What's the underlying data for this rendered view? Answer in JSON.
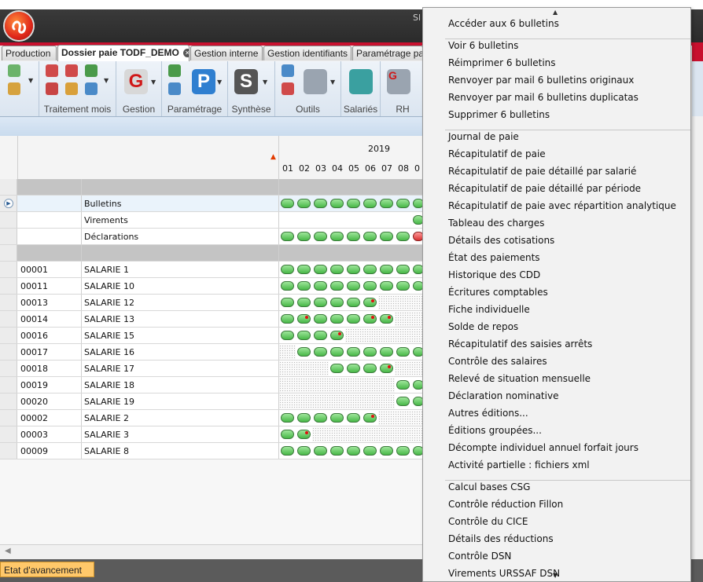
{
  "window": {
    "title": "Sl"
  },
  "tabs": [
    {
      "label": "Production"
    },
    {
      "label": "Dossier paie TODF_DEMO",
      "active": true
    },
    {
      "label": "Gestion interne"
    },
    {
      "label": "Gestion identifiants"
    },
    {
      "label": "Paramétrage pa"
    }
  ],
  "ribbon": {
    "groups": [
      {
        "label": "Traitement mois"
      },
      {
        "label": "Gestion",
        "letter": "G"
      },
      {
        "label": "Paramétrage",
        "letter": "P"
      },
      {
        "label": "Synthèse",
        "letter": "S"
      },
      {
        "label": "Outils"
      },
      {
        "label": "Salariés"
      },
      {
        "label": "RH",
        "letter": "G"
      }
    ]
  },
  "grid": {
    "year": "2019",
    "months": [
      "01",
      "02",
      "03",
      "04",
      "05",
      "06",
      "07",
      "08",
      "0"
    ],
    "summary_rows": [
      {
        "label": "Bulletins",
        "selected": true,
        "cells": [
          "g",
          "g",
          "g",
          "g",
          "g",
          "g",
          "g",
          "g",
          "gc"
        ]
      },
      {
        "label": "Virements",
        "cells": [
          "",
          "",
          "",
          "",
          "",
          "",
          "",
          "",
          "gc"
        ]
      },
      {
        "label": "Déclarations",
        "cells": [
          "g",
          "g",
          "g",
          "g",
          "g",
          "g",
          "g",
          "g",
          "rc"
        ]
      }
    ],
    "employees": [
      {
        "code": "00001",
        "name": "SALARIE 1",
        "cells": [
          "g",
          "g",
          "g",
          "g",
          "g",
          "g",
          "g",
          "g",
          "gc"
        ]
      },
      {
        "code": "00011",
        "name": "SALARIE 10",
        "cells": [
          "g",
          "g",
          "g",
          "g",
          "g",
          "g",
          "g",
          "g",
          "gc"
        ]
      },
      {
        "code": "00013",
        "name": "SALARIE 12",
        "cells": [
          "g",
          "g",
          "g",
          "g",
          "g",
          "gd",
          ".",
          ".",
          "."
        ]
      },
      {
        "code": "00014",
        "name": "SALARIE 13",
        "cells": [
          "g",
          "gd",
          "g",
          "g",
          "g",
          "gd",
          "gd",
          ".",
          "."
        ]
      },
      {
        "code": "00016",
        "name": "SALARIE 15",
        "cells": [
          "g",
          "g",
          "g",
          "gd",
          ".",
          ".",
          ".",
          ".",
          "."
        ]
      },
      {
        "code": "00017",
        "name": "SALARIE 16",
        "cells": [
          ".",
          "g",
          "g",
          "g",
          "g",
          "g",
          "g",
          "g",
          "gc"
        ]
      },
      {
        "code": "00018",
        "name": "SALARIE 17",
        "cells": [
          ".",
          ".",
          ".",
          "g",
          "g",
          "g",
          "gd",
          ".",
          "."
        ]
      },
      {
        "code": "00019",
        "name": "SALARIE 18",
        "cells": [
          ".",
          ".",
          ".",
          ".",
          ".",
          ".",
          ".",
          "g",
          "gc"
        ]
      },
      {
        "code": "00020",
        "name": "SALARIE 19",
        "cells": [
          ".",
          ".",
          ".",
          ".",
          ".",
          ".",
          ".",
          "g",
          "gc"
        ]
      },
      {
        "code": "00002",
        "name": "SALARIE 2",
        "cells": [
          "g",
          "g",
          "g",
          "g",
          "g",
          "gd",
          ".",
          ".",
          "."
        ]
      },
      {
        "code": "00003",
        "name": "SALARIE 3",
        "cells": [
          "g",
          "gd",
          ".",
          ".",
          ".",
          ".",
          ".",
          ".",
          "."
        ]
      },
      {
        "code": "00009",
        "name": "SALARIE 8",
        "cells": [
          "g",
          "g",
          "g",
          "g",
          "g",
          "g",
          "g",
          "g",
          "gc"
        ]
      }
    ]
  },
  "status": {
    "progress_label": "Etat d'avancement"
  },
  "context_menu": {
    "groups": [
      [
        "Accéder aux 6 bulletins"
      ],
      [
        "Voir 6 bulletins",
        "Réimprimer 6 bulletins",
        "Renvoyer par mail 6 bulletins originaux",
        "Renvoyer par mail 6 bulletins duplicatas",
        "Supprimer 6 bulletins"
      ],
      [
        "Journal de paie",
        "Récapitulatif de paie",
        "Récapitulatif de paie détaillé par salarié",
        "Récapitulatif de paie détaillé par période",
        "Récapitulatif de paie avec répartition analytique",
        "Tableau des charges",
        "Détails des cotisations",
        "État des paiements",
        "Historique des CDD",
        "Écritures comptables",
        "Fiche individuelle",
        "Solde de repos",
        "Récapitulatif des saisies arrêts",
        "Contrôle des salaires",
        "Relevé de situation mensuelle",
        "Déclaration nominative",
        "Autres éditions...",
        "Éditions groupées...",
        "Décompte individuel annuel forfait jours",
        "Activité partielle : fichiers xml"
      ],
      [
        "Calcul bases CSG",
        "Contrôle réduction Fillon",
        "Contrôle du CICE",
        "Détails des réductions",
        "Contrôle DSN",
        "Virements URSSAF DSN"
      ]
    ]
  },
  "colors": {
    "accent_red": "#c8102e",
    "pill_green": "#48b848",
    "pill_red": "#d83232",
    "status_button": "#ffc86a"
  }
}
